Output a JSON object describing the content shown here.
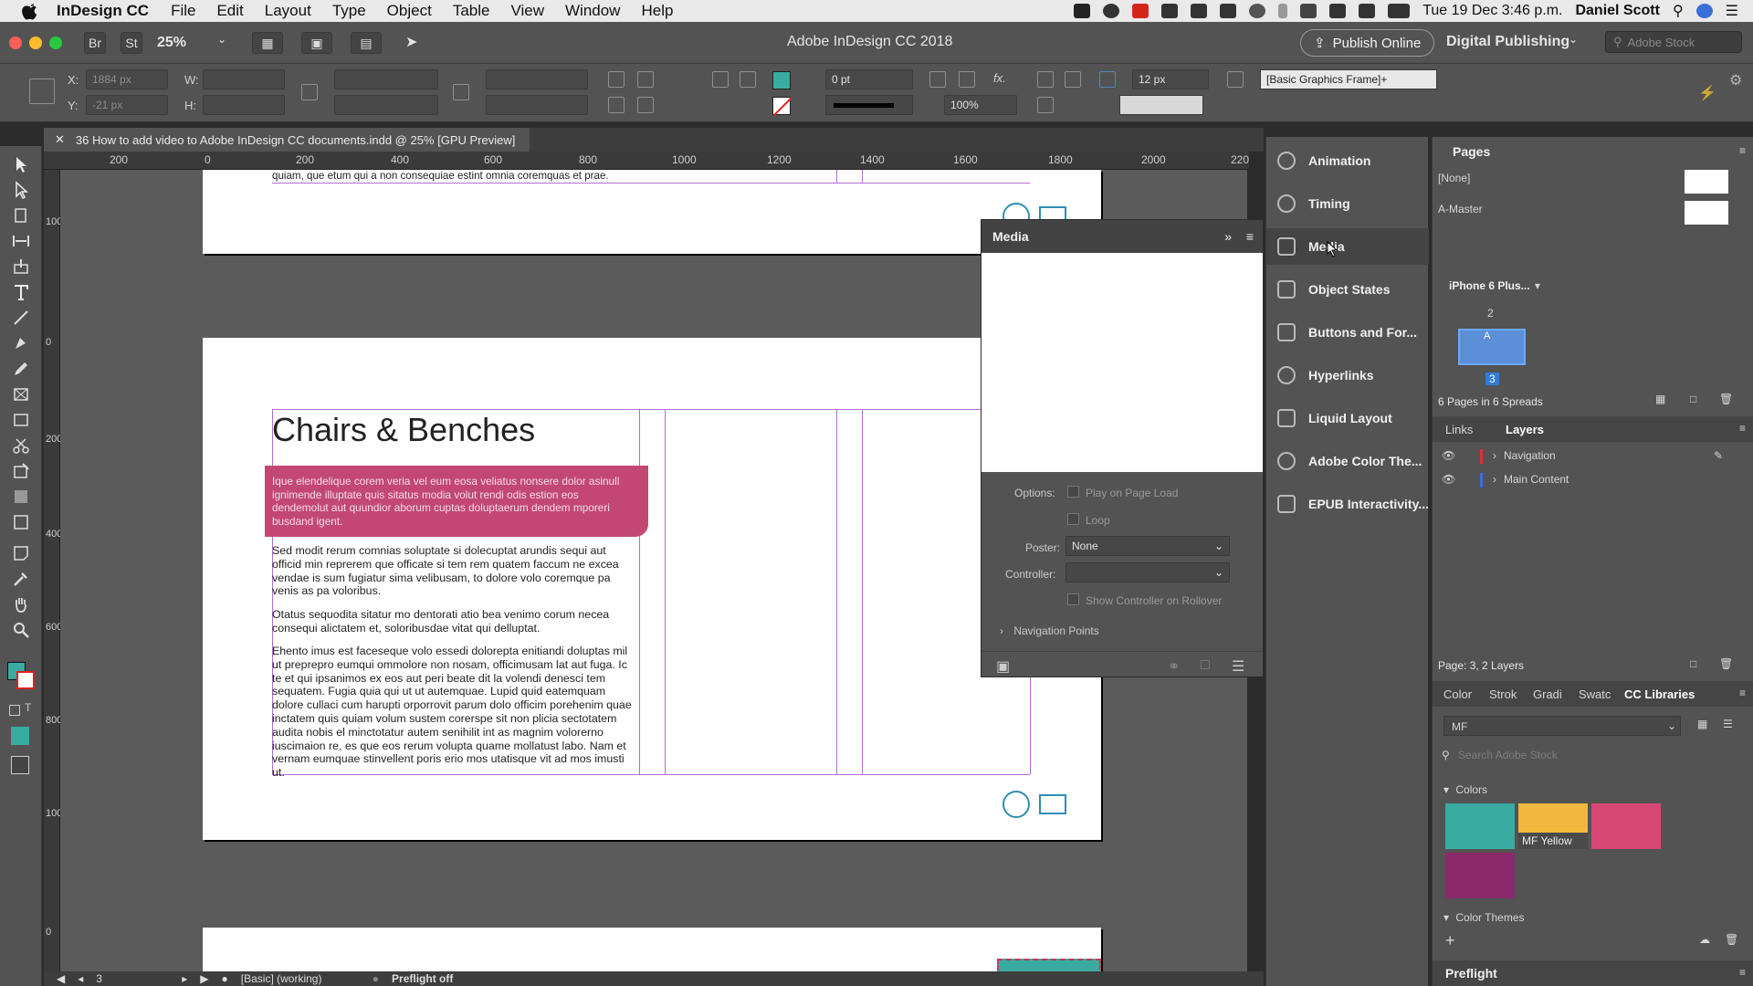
{
  "menubar": {
    "app_name": "InDesign CC",
    "items": [
      "File",
      "Edit",
      "Layout",
      "Type",
      "Object",
      "Table",
      "View",
      "Window",
      "Help"
    ],
    "clock": "Tue 19 Dec  3:46 p.m.",
    "user": "Daniel Scott"
  },
  "titlebar": {
    "title": "Adobe InDesign CC 2018",
    "br": "Br",
    "st": "St",
    "zoom": "25%",
    "publish": "Publish Online",
    "workspace": "Digital Publishing",
    "search_placeholder": "Adobe Stock"
  },
  "controlbar": {
    "x_label": "X:",
    "x_value": "1884 px",
    "y_label": "Y:",
    "y_value": "-21 px",
    "w_label": "W:",
    "h_label": "H:",
    "stroke_weight": "0 pt",
    "opacity": "100%",
    "spacing": "12 px",
    "object_style": "[Basic Graphics Frame]+"
  },
  "document": {
    "tab_title": "36 How to add video to Adobe InDesign CC documents.indd @ 25% [GPU Preview]",
    "ruler_h": [
      "200",
      "0",
      "200",
      "400",
      "600",
      "800",
      "1000",
      "1200",
      "1400",
      "1600",
      "1800",
      "2000",
      "220"
    ],
    "ruler_v": [
      "100",
      "0",
      "200",
      "400",
      "600",
      "800",
      "1000",
      "0"
    ],
    "page1_text": "quiam, que etum qui a non consequiae estint omnia coremquas et prae.",
    "heading": "Chairs & Benches",
    "callout": "Ique elendelique corem veria vel eum eosa veliatus nonsere dolor asinull ignimende illuptate quis sitatus modia volut rendi odis estion eos dendemolut aut quundior aborum cuptas doluptaerum dendem mporeri busdand igent.",
    "para1": "Sed modit rerum comnias soluptate si dolecuptat arundis sequi aut officid min reprerem que officate si tem rem quatem faccum ne excea vendae is sum fugiatur sima velibusam, to dolore volo coremque pa venis as pa voloribus.",
    "para2": "Otatus sequodita sitatur mo dentorati atio bea venimo corum necea consequi alictatem et, soloribusdae vitat qui delluptat.",
    "para3": "Ehento imus est faceseque volo essedi dolorepta enitiandi doluptas mil ut preprepro eumqui ommolore non nosam, officimusam lat aut fuga. Ic te et qui ipsanimos ex eos aut peri beate dit la volendi denesci tem sequatem. Fugia quia qui ut ut autemquae. Lupid quid eatemquam dolore cullaci cum harupti orporrovit parum dolo officim porehenim quae inctatem quis quiam volum sustem corerspe sit non plicia sectotatem audita nobis el minctotatur autem senihilit int as magnim volorerno iuscimaion re, es que eos rerum volupta quame mollatust labo. Nam et vernam eumquae stinvellent poris erio mos utatisque vit ad mos imusti ut."
  },
  "statusbar": {
    "page": "3",
    "profile": "[Basic] (working)",
    "preflight": "Preflight off"
  },
  "media_panel": {
    "title": "Media",
    "options_label": "Options:",
    "play_on_load": "Play on Page Load",
    "loop": "Loop",
    "poster_label": "Poster:",
    "poster_value": "None",
    "controller_label": "Controller:",
    "show_controller": "Show Controller on Rollover",
    "nav_points": "Navigation Points"
  },
  "dock": {
    "items": [
      "Animation",
      "Timing",
      "Media",
      "Object States",
      "Buttons and For...",
      "Hyperlinks",
      "Liquid Layout",
      "Adobe Color The...",
      "EPUB Interactivity..."
    ]
  },
  "pages_panel": {
    "title": "Pages",
    "none": "[None]",
    "master": "A-Master",
    "device": "iPhone 6 Plus...",
    "spread_num": "2",
    "page_num": "3",
    "summary": "6 Pages in 6 Spreads"
  },
  "layers_panel": {
    "tab_links": "Links",
    "tab_layers": "Layers",
    "layers": [
      "Navigation",
      "Main Content"
    ],
    "footer": "Page: 3, 2 Layers"
  },
  "libraries_panel": {
    "tabs": [
      "Color",
      "Strok",
      "Gradi",
      "Swatc",
      "CC Libraries"
    ],
    "library": "MF",
    "search_placeholder": "Search Adobe Stock",
    "colors_label": "Colors",
    "swatch_yellow_label": "MF Yellow",
    "themes_label": "Color Themes",
    "preflight": "Preflight",
    "colors": [
      "#3aaba1",
      "#f0b83e",
      "#d94776",
      "#8b2a6a"
    ]
  }
}
